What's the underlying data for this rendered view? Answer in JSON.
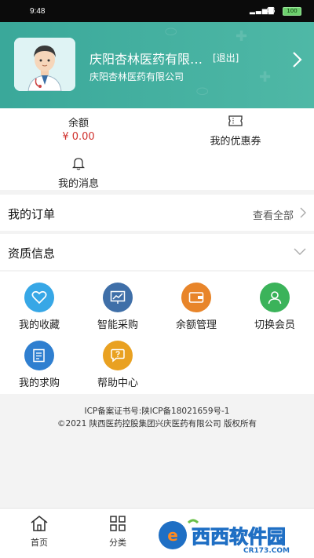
{
  "status_bar": {
    "time": "9:48",
    "network": "4G",
    "battery": "100"
  },
  "header": {
    "store_name": "庆阳杏林医药有限公司",
    "logout": "[退出]",
    "store_subtitle": "庆阳杏林医药有限公司"
  },
  "stats": {
    "balance_label": "余额",
    "balance_value": "¥ 0.00",
    "coupon_label": "我的优惠券",
    "messages_label": "我的消息"
  },
  "orders": {
    "title": "我的订单",
    "view_all": "查看全部"
  },
  "qualification": {
    "title": "资质信息"
  },
  "grid": {
    "items": [
      {
        "label": "我的收藏",
        "icon": "heart-icon",
        "color": "#37a7e6"
      },
      {
        "label": "智能采购",
        "icon": "chart-board-icon",
        "color": "#3f6fa8"
      },
      {
        "label": "余额管理",
        "icon": "wallet-icon",
        "color": "#e8852a"
      },
      {
        "label": "切换会员",
        "icon": "member-icon",
        "color": "#3bb35a"
      },
      {
        "label": "我的求购",
        "icon": "note-edit-icon",
        "color": "#2f7fd0"
      },
      {
        "label": "帮助中心",
        "icon": "help-chat-icon",
        "color": "#e9a121"
      }
    ]
  },
  "footer": {
    "icp": "ICP备案证书号:陕ICP备18021659号-1",
    "copyright": "©2021 陕西医药控股集团兴庆医药有限公司 版权所有"
  },
  "tabbar": {
    "home": "首页",
    "category": "分类"
  },
  "watermark": {
    "brand": "西西软件园",
    "site": "CR173.COM"
  },
  "colors": {
    "header": "#3aa89a",
    "price": "#d0312d"
  }
}
